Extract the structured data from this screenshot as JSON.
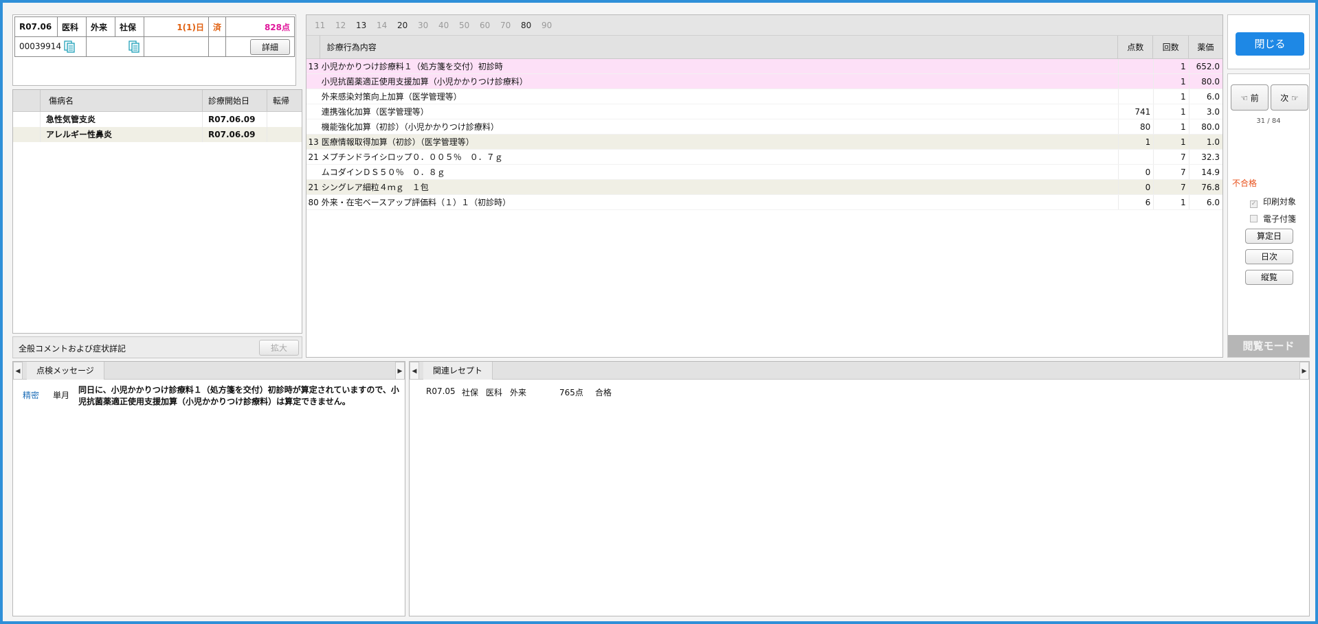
{
  "header": {
    "date": "R07.06",
    "category": "医科",
    "visit_type": "外来",
    "insurance": "社保",
    "days": "1(1)日",
    "done": "済",
    "points": "828点",
    "patient_id": "00039914",
    "detail_button": "詳細",
    "copy_icon": "copy-icon"
  },
  "diagnosis": {
    "columns": [
      "傷病名",
      "診療開始日",
      "転帰"
    ],
    "rows": [
      {
        "name": "急性気管支炎",
        "start": "R07.06.09",
        "outcome": ""
      },
      {
        "name": "アレルギー性鼻炎",
        "start": "R07.06.09",
        "outcome": ""
      }
    ]
  },
  "comment": {
    "label": "全般コメントおよび症状詳記",
    "expand_button": "拡大"
  },
  "days_bar": [
    "11",
    "12",
    "13",
    "14",
    "20",
    "30",
    "40",
    "50",
    "60",
    "70",
    "80",
    "90"
  ],
  "acts": {
    "columns": [
      "診療行為内容",
      "点数",
      "回数",
      "薬価"
    ],
    "rows": [
      {
        "code": "13",
        "content": "小児かかりつけ診療料１（処方箋を交付）初診時",
        "points": "",
        "count": "1",
        "price": "652.0",
        "style": "pink"
      },
      {
        "code": "",
        "content": "小児抗菌薬適正使用支援加算（小児かかりつけ診療料）",
        "points": "",
        "count": "1",
        "price": "80.0",
        "style": "pink"
      },
      {
        "code": "",
        "content": "外来感染対策向上加算（医学管理等）",
        "points": "",
        "count": "1",
        "price": "6.0",
        "style": ""
      },
      {
        "code": "",
        "content": "連携強化加算（医学管理等）",
        "points": "741",
        "count": "1",
        "price": "3.0",
        "style": ""
      },
      {
        "code": "",
        "content": "機能強化加算（初診）（小児かかりつけ診療料）",
        "points": "80",
        "count": "1",
        "price": "80.0",
        "style": ""
      },
      {
        "code": "13",
        "content": "医療情報取得加算（初診）（医学管理等）",
        "points": "1",
        "count": "1",
        "price": "1.0",
        "style": "beige"
      },
      {
        "code": "21",
        "content": "メプチンドライシロップ０．００５％　０．７ｇ",
        "points": "",
        "count": "7",
        "price": "32.3",
        "style": ""
      },
      {
        "code": "",
        "content": "ムコダインＤＳ５０％　０．８ｇ",
        "points": "0",
        "count": "7",
        "price": "14.9",
        "style": ""
      },
      {
        "code": "21",
        "content": "シングレア細粒４ｍｇ　１包",
        "points": "0",
        "count": "7",
        "price": "76.8",
        "style": "beige"
      },
      {
        "code": "80",
        "content": "外来・在宅ベースアップ評価料（１）１（初診時）",
        "points": "6",
        "count": "1",
        "price": "6.0",
        "style": ""
      }
    ]
  },
  "right": {
    "close_button": "閉じる",
    "prev_button": "前",
    "next_button": "次",
    "prev_icon": "hand-pointing-left-icon",
    "next_icon": "hand-pointing-right-icon",
    "counter": "31 / 84",
    "status": "不合格",
    "status_color": "#e8501a",
    "print_target": "印刷対象",
    "e_sticky": "電子付箋",
    "calc_day_button": "算定日",
    "daily_button": "日次",
    "overview_button": "縦覧",
    "mode_label": "閲覧モード"
  },
  "messages": {
    "tab": "点検メッセージ",
    "rows": [
      {
        "type": "精密",
        "scope": "単月",
        "text": "同日に、小児かかりつけ診療料１（処方箋を交付）初診時が算定されていますので、小児抗菌薬適正使用支援加算（小児かかりつけ診療料）は算定できません。"
      }
    ]
  },
  "related": {
    "tab": "関連レセプト",
    "rows": [
      {
        "date": "R07.05",
        "insurance": "社保",
        "category": "医科",
        "visit_type": "外来",
        "points": "765点",
        "result": "合格"
      }
    ]
  },
  "colors": {
    "frame": "#2f8fd8",
    "pink_row": "#fde0f7",
    "beige_row": "#f0efe5",
    "close_button": "#1e88e5"
  }
}
